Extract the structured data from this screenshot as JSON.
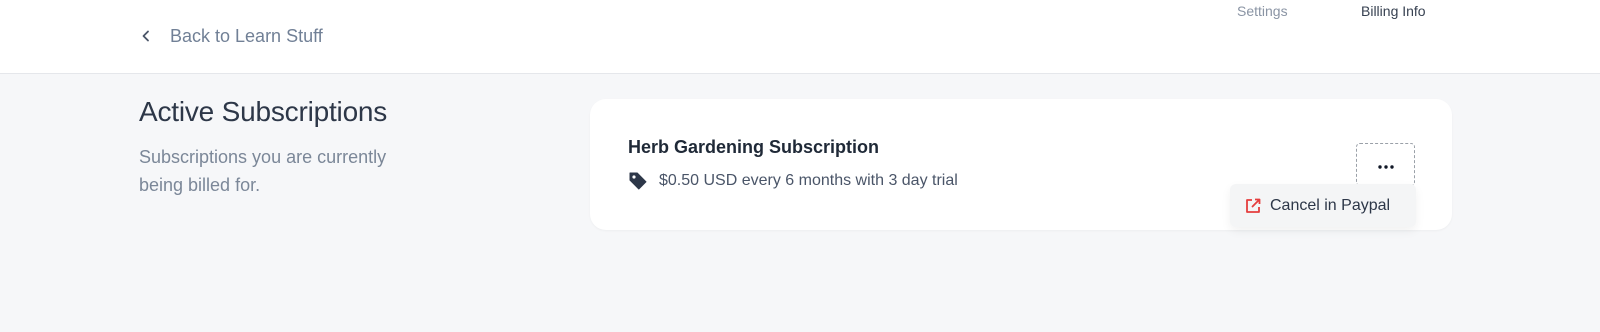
{
  "header": {
    "back_label": "Back to Learn Stuff",
    "nav": {
      "settings": "Settings",
      "billing_info": "Billing Info"
    }
  },
  "section": {
    "title": "Active Subscriptions",
    "subtitle": "Subscriptions you are currently being billed for."
  },
  "subscription": {
    "name": "Herb Gardening Subscription",
    "price_text": "$0.50 USD every 6 months with 3 day trial",
    "actions": {
      "more_icon": "ellipsis-icon",
      "menu": [
        {
          "label": "Cancel in Paypal",
          "icon": "external-link-icon",
          "icon_color": "#e53e3e"
        }
      ]
    }
  },
  "colors": {
    "background": "#f6f7f9",
    "card": "#ffffff",
    "accent_danger": "#e53e3e"
  }
}
